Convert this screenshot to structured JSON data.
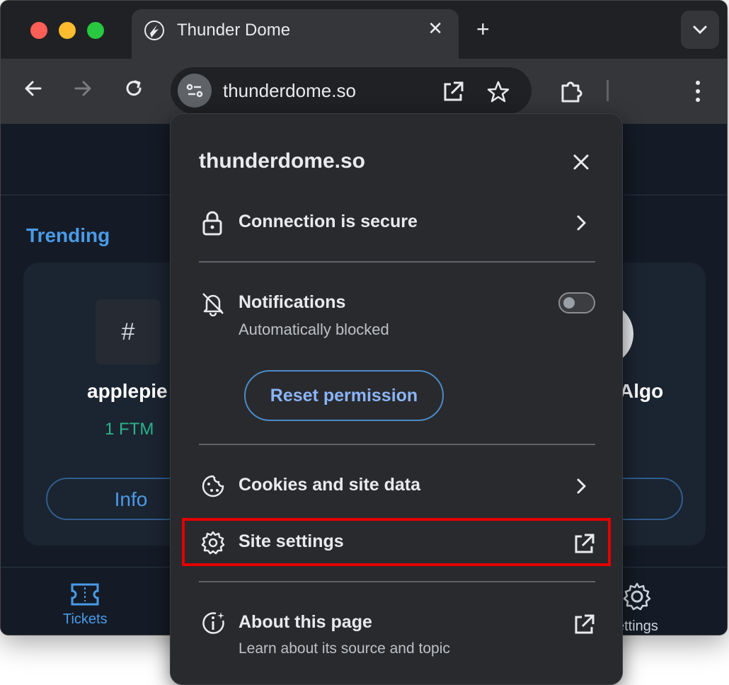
{
  "browser": {
    "tab_title": "Thunder Dome",
    "url": "thunderdome.so"
  },
  "page": {
    "section_title": "Trending",
    "card_left": {
      "name": "applepie",
      "value": "1 FTM",
      "button": "Info"
    },
    "card_right": {
      "name": "Algo"
    },
    "nav": {
      "tickets": "Tickets",
      "settings": "ettings"
    }
  },
  "popup": {
    "title": "thunderdome.so",
    "connection": "Connection is secure",
    "notifications": {
      "label": "Notifications",
      "status": "Automatically blocked",
      "toggle_on": false
    },
    "reset_button": "Reset permission",
    "cookies": "Cookies and site data",
    "site_settings": "Site settings",
    "about": {
      "label": "About this page",
      "sub": "Learn about its source and topic"
    }
  },
  "colors": {
    "accent": "#4a9be8",
    "highlight": "#e50000",
    "coin_value": "#2bb58b"
  },
  "icons": [
    "lock-icon",
    "bell-off-icon",
    "cookie-icon",
    "gear-icon",
    "info-sparkle-icon",
    "external-link-icon",
    "chevron-right-icon",
    "close-icon",
    "star-icon",
    "puzzle-icon",
    "reload-icon",
    "back-arrow-icon",
    "forward-arrow-icon",
    "tune-icon",
    "kebab-menu-icon",
    "ticket-icon"
  ]
}
